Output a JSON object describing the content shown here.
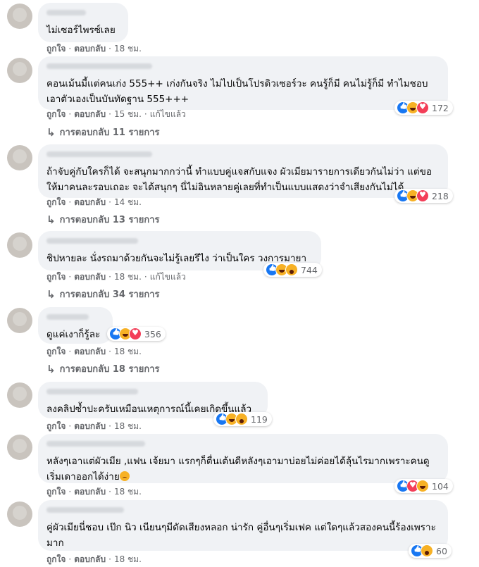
{
  "comments": [
    {
      "text": "ไม่เซอร์ไพรซ์เลย",
      "like": "ถูกใจ",
      "reply": "ตอบกลับ",
      "time": "18 ชม.",
      "edited": "",
      "reactions_count": "",
      "replies_label": ""
    },
    {
      "text": "คอนเม้นมี้แต่คนเก่ง 555++ เก่งกันจริง ไม่ไปเป็นโปรดิวเซอร์วะ คนรู้ก็มี คนไม่รู้ก็มี ทำไมชอบเอาตัวเองเป็นบันทัดฐาน 555+++",
      "like": "ถูกใจ",
      "reply": "ตอบกลับ",
      "time": "15 ชม.",
      "edited": "แก้ไขแล้ว",
      "reactions_count": "172",
      "reactions": [
        "like-icon",
        "haha-icon",
        "love-icon"
      ],
      "replies_label": "การตอบกลับ 11 รายการ"
    },
    {
      "text": "ถ้าจับคู่กับใครก็ได้ จะสนุกมากกว่านี้ ทำแบบคู่แจสกับแจง ผัวเมียมารายการเดียวกันไม่ว่า แต่ขอให้มาคนละรอบเถอะ จะได้สนุกๆ นี่ไม่อินหลายคู่เลยที่ทำเป็นแบบแสดงว่าจำเสียงกันไม่ได้",
      "like": "ถูกใจ",
      "reply": "ตอบกลับ",
      "time": "14 ชม.",
      "edited": "",
      "reactions_count": "218",
      "reactions": [
        "like-icon",
        "haha-icon",
        "love-icon"
      ],
      "replies_label": "การตอบกลับ 13 รายการ"
    },
    {
      "text": "ชิปหายละ นั่งรถมาด้วยกันจะไม่รู้เลยรึไง ว่าเป็นใคร วงการมายา",
      "like": "ถูกใจ",
      "reply": "ตอบกลับ",
      "time": "18 ชม.",
      "edited": "แก้ไขแล้ว",
      "reactions_count": "744",
      "reactions": [
        "like-icon",
        "haha-icon",
        "wow-icon"
      ],
      "replies_label": "การตอบกลับ 34 รายการ"
    },
    {
      "text": "ดูแค่เงาก็รู้ละ",
      "like": "ถูกใจ",
      "reply": "ตอบกลับ",
      "time": "18 ชม.",
      "edited": "",
      "reactions_count": "356",
      "reactions": [
        "like-icon",
        "haha-icon",
        "love-icon"
      ],
      "replies_label": "การตอบกลับ 18 รายการ"
    },
    {
      "text": "ลงคลิปซ้ำปะครับเหมือนเหตุการณ์นี้เคยเกิดขึ้นแล้ว",
      "like": "ถูกใจ",
      "reply": "ตอบกลับ",
      "time": "18 ชม.",
      "edited": "",
      "reactions_count": "119",
      "reactions": [
        "like-icon",
        "haha-icon",
        "wow-icon"
      ],
      "replies_label": ""
    },
    {
      "text": "หลังๆเอาแต่ผัวเมีย ,แฟน เจ้ยมา แรกๆก็ตื่นเต้นดีหลังๆเอามาบ่อยไม่ค่อยได้ลุ้นไรมากเพราะคนดูเริ่มเดาออกได้ง่าย",
      "like": "ถูกใจ",
      "reply": "ตอบกลับ",
      "time": "18 ชม.",
      "edited": "",
      "reactions_count": "104",
      "reactions": [
        "like-icon",
        "love-icon",
        "haha-icon"
      ],
      "replies_label": ""
    },
    {
      "text": "คู่ผัวเมียนี่ชอบ เป๊ก นิว เนียนๆมีดัดเสียงหลอก น่ารัก คู่อื่นๆเริ่มเฟค แต่ใดๆแล้วสองคนนี้ร้องเพราะมาก",
      "like": "ถูกใจ",
      "reply": "ตอบกลับ",
      "time": "18 ชม.",
      "edited": "",
      "reactions_count": "60",
      "reactions": [
        "like-icon",
        "wow-icon"
      ],
      "replies_label": ""
    }
  ],
  "colors": {
    "bubble": "#f0f2f5",
    "meta": "#65676b",
    "like": "#1877f2",
    "love": "#f33e58",
    "haha": "#f7b125"
  }
}
